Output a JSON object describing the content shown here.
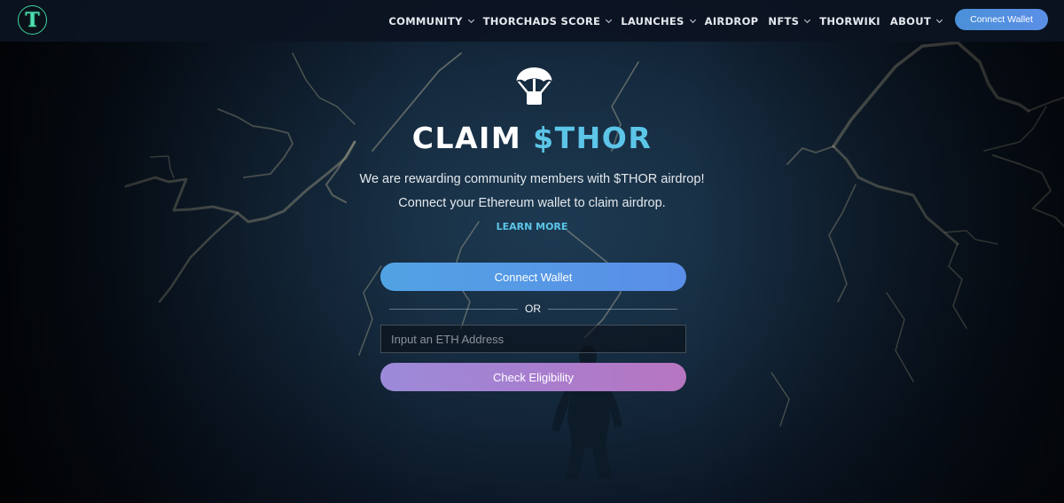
{
  "nav": {
    "logo_glyph": "T",
    "items": [
      {
        "label": "COMMUNITY",
        "dropdown": true
      },
      {
        "label": "THORCHADS SCORE",
        "dropdown": true
      },
      {
        "label": "LAUNCHES",
        "dropdown": true
      },
      {
        "label": "AIRDROP",
        "dropdown": false
      },
      {
        "label": "NFTS",
        "dropdown": true
      },
      {
        "label": "THORWIKI",
        "dropdown": false
      },
      {
        "label": "ABOUT",
        "dropdown": true
      }
    ],
    "connect_wallet_label": "Connect Wallet"
  },
  "hero": {
    "icon": "parachute-airdrop-icon",
    "title_white": "CLAIM",
    "title_accent": "$THOR",
    "line1": "We are rewarding community members with $THOR airdrop!",
    "line2": "Connect your Ethereum wallet to claim airdrop.",
    "learn_more": "LEARN MORE"
  },
  "claim_form": {
    "connect_wallet_label": "Connect Wallet",
    "divider_text": "OR",
    "eth_input_value": "",
    "eth_input_placeholder": "Input an ETH Address",
    "check_button_label": "Check Eligibility"
  },
  "colors": {
    "accent_cyan": "#5cc5e8",
    "connect_blue": "#52a3e3",
    "check_purple": "#a87ecf",
    "logo_green": "#3ed6a0"
  }
}
